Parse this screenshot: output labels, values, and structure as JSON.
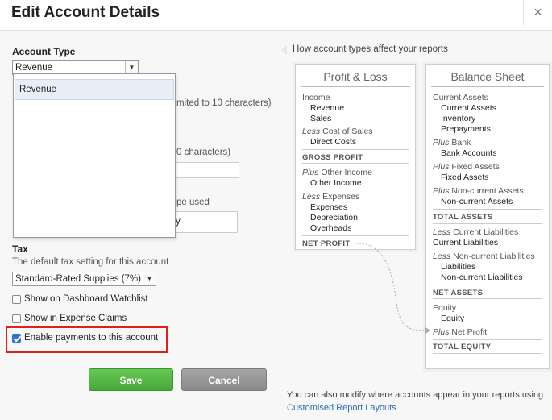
{
  "dialog": {
    "title": "Edit Account Details",
    "close_glyph": "×"
  },
  "account_type": {
    "label": "Account Type",
    "selected": "Revenue",
    "options": [
      "Revenue"
    ]
  },
  "hidden_fields": {
    "code_hint_partial": "mited to 10 characters)",
    "name_hint_partial": "0 characters)",
    "desc_hint_partial": "pe used",
    "desc_value_partial": "y"
  },
  "tax": {
    "label": "Tax",
    "help": "The default tax setting for this account",
    "selected": "Standard-Rated Supplies (7%)"
  },
  "checkboxes": [
    {
      "label": "Show on Dashboard Watchlist",
      "checked": false
    },
    {
      "label": "Show in Expense Claims",
      "checked": false
    },
    {
      "label": "Enable payments to this account",
      "checked": true
    }
  ],
  "buttons": {
    "save": "Save",
    "cancel": "Cancel"
  },
  "info": {
    "heading": "How account types affect your reports",
    "footnote_text": "You can also modify where accounts appear in your reports using",
    "footnote_link": "Customised Report Layouts"
  },
  "profit_loss": {
    "title": "Profit & Loss",
    "income": "Income",
    "income_items": [
      "Revenue",
      "Sales"
    ],
    "less1": "Less",
    "cost_of_sales": "Cost of Sales",
    "cos_items": [
      "Direct Costs"
    ],
    "gross_profit": "GROSS PROFIT",
    "plus1": "Plus",
    "other_income": "Other Income",
    "oi_items": [
      "Other Income"
    ],
    "less2": "Less",
    "expenses": "Expenses",
    "exp_items": [
      "Expenses",
      "Depreciation",
      "Overheads"
    ],
    "net_profit": "NET PROFIT"
  },
  "balance_sheet": {
    "title": "Balance Sheet",
    "current_assets": "Current Assets",
    "ca_items": [
      "Current Assets",
      "Inventory",
      "Prepayments"
    ],
    "plus1": "Plus",
    "bank": "Bank",
    "bank_items": [
      "Bank Accounts"
    ],
    "plus2": "Plus",
    "fixed_assets": "Fixed Assets",
    "fa_items": [
      "Fixed Assets"
    ],
    "plus3": "Plus",
    "non_current_assets": "Non-current Assets",
    "nca_items": [
      "Non-current Assets"
    ],
    "total_assets": "TOTAL ASSETS",
    "less1": "Less",
    "current_liabilities": "Current Liabilities",
    "cl_items": [
      "Current Liabilities"
    ],
    "less2": "Less",
    "non_current_liabilities": "Non-current Liabilities",
    "ncl_items": [
      "Liabilities",
      "Non-current Liabilities"
    ],
    "net_assets": "NET ASSETS",
    "equity": "Equity",
    "eq_items": [
      "Equity"
    ],
    "plus4": "Plus",
    "net_profit": "Net Profit",
    "total_equity": "TOTAL EQUITY"
  },
  "colors": {
    "accent": "#2a6fb0",
    "save": "#4fb443",
    "highlight": "#e0201b"
  }
}
